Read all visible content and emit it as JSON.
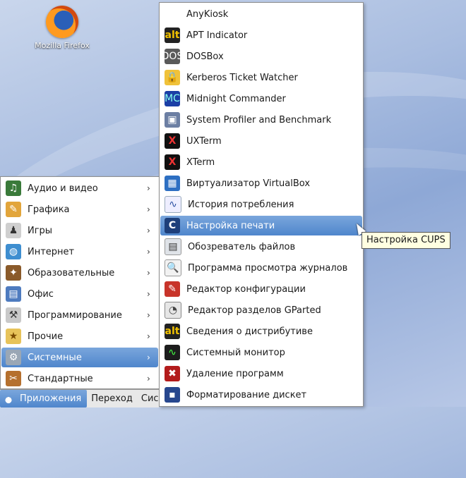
{
  "desktop": {
    "icons": [
      {
        "label": "Mozilla Firefox",
        "icon": "firefox-icon"
      }
    ]
  },
  "main_menu": {
    "items": [
      {
        "label": "Аудио и видео",
        "icon": "audio-video-icon",
        "glyph": "♫"
      },
      {
        "label": "Графика",
        "icon": "graphics-icon",
        "glyph": "✎"
      },
      {
        "label": "Игры",
        "icon": "games-icon",
        "glyph": "♟"
      },
      {
        "label": "Интернет",
        "icon": "internet-icon",
        "glyph": "◍"
      },
      {
        "label": "Образовательные",
        "icon": "education-icon",
        "glyph": "✦"
      },
      {
        "label": "Офис",
        "icon": "office-icon",
        "glyph": "▤"
      },
      {
        "label": "Программирование",
        "icon": "programming-icon",
        "glyph": "⚒"
      },
      {
        "label": "Прочие",
        "icon": "misc-icon",
        "glyph": "★"
      },
      {
        "label": "Системные",
        "icon": "system-icon",
        "glyph": "⚙",
        "selected": true
      },
      {
        "label": "Стандартные",
        "icon": "accessories-icon",
        "glyph": "✂"
      }
    ]
  },
  "sub_menu": {
    "items": [
      {
        "label": "AnyKiosk",
        "icon": "blank-icon",
        "glyph": ""
      },
      {
        "label": "APT Indicator",
        "icon": "alt-linux-icon",
        "glyph": "alt"
      },
      {
        "label": "DOSBox",
        "icon": "dosbox-icon",
        "glyph": "DOS"
      },
      {
        "label": "Kerberos Ticket Watcher",
        "icon": "lock-icon",
        "glyph": "🔒"
      },
      {
        "label": "Midnight Commander",
        "icon": "midnight-commander-icon",
        "glyph": "MC"
      },
      {
        "label": "System Profiler and Benchmark",
        "icon": "system-profiler-icon",
        "glyph": "▣"
      },
      {
        "label": "UXTerm",
        "icon": "uxterm-icon",
        "glyph": "X"
      },
      {
        "label": "XTerm",
        "icon": "xterm-icon",
        "glyph": "X"
      },
      {
        "label": "Виртуализатор VirtualBox",
        "icon": "virtualbox-icon",
        "glyph": "▦"
      },
      {
        "label": "История потребления",
        "icon": "usage-history-icon",
        "glyph": "∿"
      },
      {
        "label": "Настройка печати",
        "icon": "cups-icon",
        "glyph": "C",
        "selected": true
      },
      {
        "label": "Обозреватель файлов",
        "icon": "file-browser-icon",
        "glyph": "▤"
      },
      {
        "label": "Программа просмотра журналов",
        "icon": "log-viewer-icon",
        "glyph": "🔍"
      },
      {
        "label": "Редактор конфигурации",
        "icon": "config-editor-icon",
        "glyph": "✎"
      },
      {
        "label": "Редактор разделов GParted",
        "icon": "gparted-icon",
        "glyph": "◔"
      },
      {
        "label": "Сведения о дистрибутиве",
        "icon": "alt-linux-icon",
        "glyph": "alt"
      },
      {
        "label": "Системный монитор",
        "icon": "system-monitor-icon",
        "glyph": "∿"
      },
      {
        "label": "Удаление программ",
        "icon": "remove-programs-icon",
        "glyph": "✖"
      },
      {
        "label": "Форматирование дискет",
        "icon": "floppy-icon",
        "glyph": "▪"
      }
    ]
  },
  "tooltip": {
    "text": "Настройка CUPS"
  },
  "taskbar": {
    "applications": "Приложения",
    "places": "Переход",
    "system": "Сис"
  }
}
